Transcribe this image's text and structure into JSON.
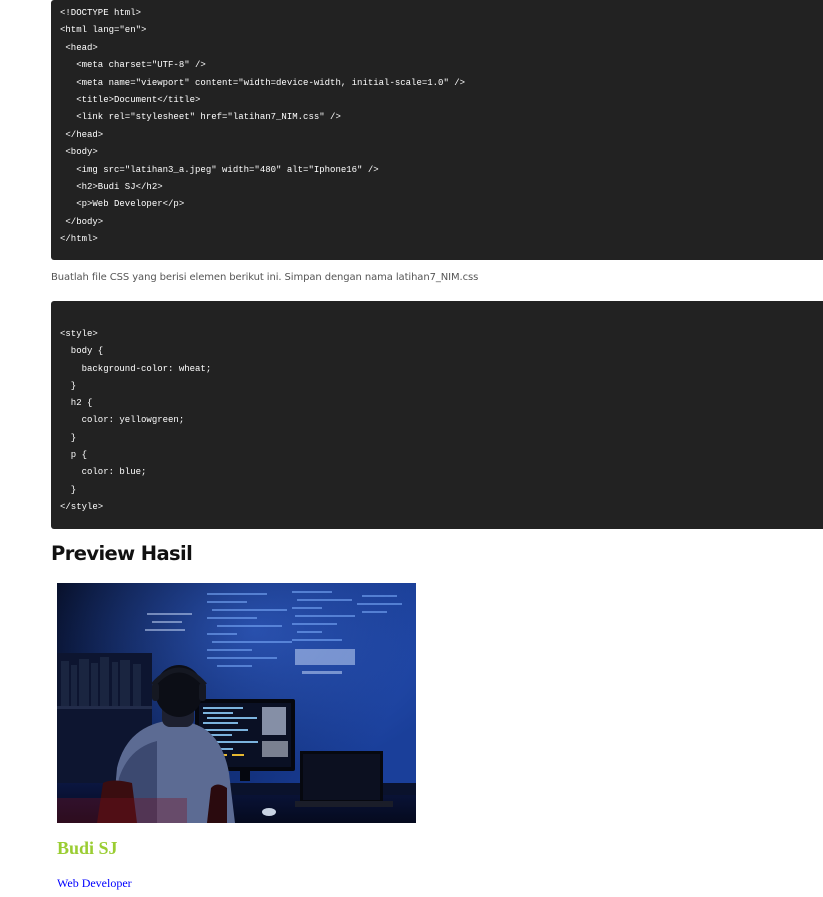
{
  "html_code": {
    "lines": [
      "<!DOCTYPE html>",
      "<html lang=\"en\">",
      " <head>",
      "   <meta charset=\"UTF-8\" />",
      "   <meta name=\"viewport\" content=\"width=device-width, initial-scale=1.0\" />",
      "   <title>Document</title>",
      "   <link rel=\"stylesheet\" href=\"latihan7_NIM.css\" />",
      " </head>",
      " <body>",
      "   <img src=\"latihan3_a.jpeg\" width=\"480\" alt=\"Iphone16\" />",
      "   <h2>Budi SJ</h2>",
      "   <p>Web Developer</p>",
      " </body>",
      "</html>"
    ]
  },
  "instruction_text": "Buatlah file CSS yang berisi elemen berikut ini. Simpan dengan nama latihan7_NIM.css",
  "css_code": {
    "lines": [
      "<style>",
      "  body {",
      "    background-color: wheat;",
      "  }",
      "  h2 {",
      "    color: yellowgreen;",
      "  }",
      "  p {",
      "    color: blue;",
      "  }",
      "</style>"
    ]
  },
  "section_title": "Preview Hasil",
  "preview": {
    "image_alt": "Iphone16",
    "name": "Budi SJ",
    "role": "Web Developer",
    "name_color": "#9acd32",
    "role_color": "#0000ff"
  },
  "colors": {
    "code_background": "#222222",
    "code_text": "#ffffff"
  }
}
